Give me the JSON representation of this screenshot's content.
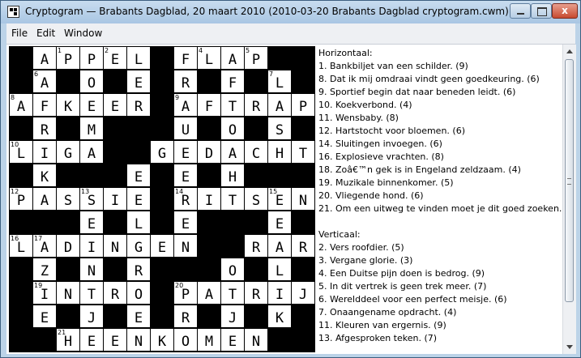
{
  "window": {
    "title": "Cryptogram — Brabants Dagblad, 20 maart 2010 (2010-03-20 Brabants Dagblad cryptogram.cwm)",
    "close_label": "x"
  },
  "menu": [
    "File",
    "Edit",
    "Window"
  ],
  "grid": {
    "size": 13,
    "rows": [
      "#APPEL#FLAP##",
      "#A#O#E#R#F#L#",
      "AFKEER#AFTRAP",
      "#R#M###U#O#S#",
      "LIGA##GEDACHTE",
      "#K###E#E#H###",
      "PASSIE#RITSEN",
      "###E#L#E###E#",
      "LADINGEN##RARE",
      "#Z#N#R###O#L#",
      "#INTRO#PATRIJS",
      "#E#J#E#R#J#K#",
      "##HEENKOMEN##"
    ],
    "numbers": [
      {
        "r": 0,
        "c": 2,
        "n": "1"
      },
      {
        "r": 0,
        "c": 4,
        "n": "2"
      },
      {
        "r": 0,
        "c": 6,
        "n": "3"
      },
      {
        "r": 0,
        "c": 8,
        "n": "4"
      },
      {
        "r": 0,
        "c": 10,
        "n": "5"
      },
      {
        "r": 1,
        "c": 1,
        "n": "6"
      },
      {
        "r": 1,
        "c": 11,
        "n": "7"
      },
      {
        "r": 2,
        "c": 0,
        "n": "8"
      },
      {
        "r": 2,
        "c": 7,
        "n": "9"
      },
      {
        "r": 4,
        "c": 0,
        "n": "10"
      },
      {
        "r": 4,
        "c": 5,
        "n": "11"
      },
      {
        "r": 6,
        "c": 0,
        "n": "12"
      },
      {
        "r": 6,
        "c": 3,
        "n": "13"
      },
      {
        "r": 6,
        "c": 7,
        "n": "14"
      },
      {
        "r": 6,
        "c": 11,
        "n": "15"
      },
      {
        "r": 8,
        "c": 0,
        "n": "16"
      },
      {
        "r": 8,
        "c": 1,
        "n": "17"
      },
      {
        "r": 8,
        "c": 9,
        "n": "18"
      },
      {
        "r": 10,
        "c": 1,
        "n": "19"
      },
      {
        "r": 10,
        "c": 7,
        "n": "20"
      },
      {
        "r": 12,
        "c": 2,
        "n": "21"
      }
    ]
  },
  "clues": {
    "horizontal_heading": "Horizontaal:",
    "horizontal": [
      "1. Bankbiljet van een schilder. (9)",
      "8. Dat ik mij omdraai vindt geen goedkeuring. (6)",
      "9. Sportief begin dat naar beneden leidt. (6)",
      "10. Koekverbond. (4)",
      "11. Wensbaby. (8)",
      "12. Hartstocht voor bloemen. (6)",
      "14. Sluitingen invoegen. (6)",
      "16. Explosieve vrachten. (8)",
      "18. Zoâ€™n gek is in Engeland zeldzaam. (4)",
      "19. Muzikale binnenkomer. (5)",
      "20. Vliegende hond. (6)",
      "21. Om een uitweg te vinden moet je dit goed zoeken. (8)"
    ],
    "vertical_heading": "Verticaal:",
    "vertical": [
      "2. Vers roofdier. (5)",
      "3. Vergane glorie. (3)",
      "4. Een Duitse pijn doen is bedrog. (9)",
      "5. In dit vertrek is geen trek meer. (7)",
      "6. Werelddeel voor een perfect meisje. (6)",
      "7. Onaangename opdracht. (4)",
      "11. Kleuren van ergernis. (9)",
      "13. Afgesproken teken. (7)"
    ]
  },
  "colors": {
    "titlebar": "#a9c6e3",
    "grid_black": "#000000",
    "cell_white": "#ffffff"
  }
}
